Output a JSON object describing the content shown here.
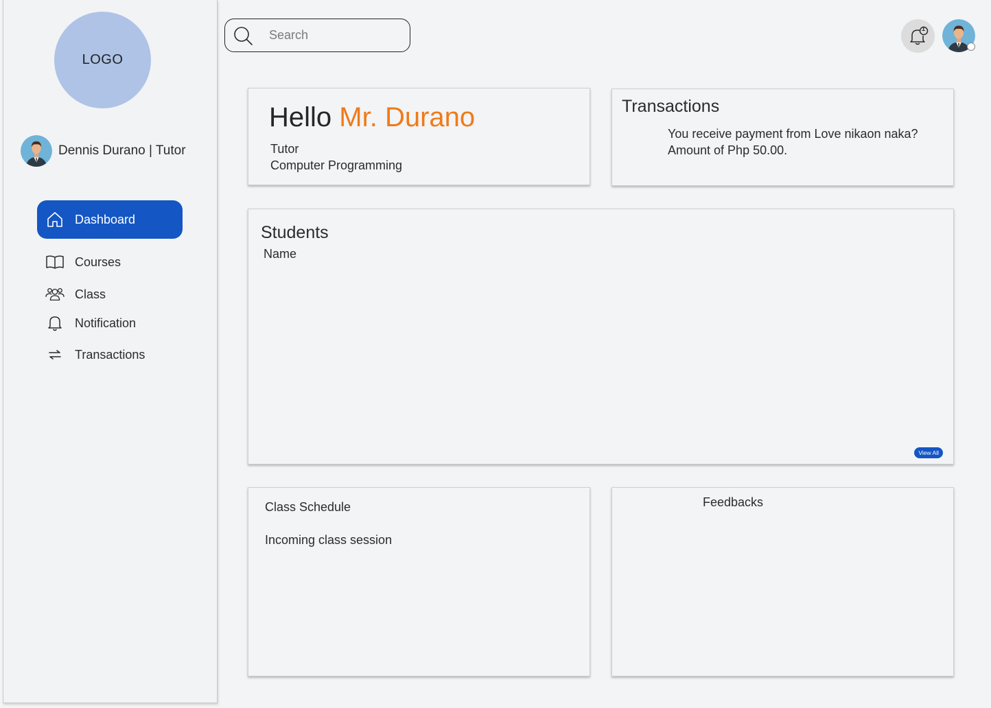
{
  "sidebar": {
    "logo_text": "LOGO",
    "profile_name": "Dennis Durano | Tutor",
    "nav": [
      {
        "label": "Dashboard",
        "icon": "home-icon",
        "active": true
      },
      {
        "label": "Courses",
        "icon": "book-icon",
        "active": false
      },
      {
        "label": "Class",
        "icon": "group-icon",
        "active": false
      },
      {
        "label": "Notification",
        "icon": "bell-icon",
        "active": false
      },
      {
        "label": "Transactions",
        "icon": "swap-icon",
        "active": false
      }
    ]
  },
  "header": {
    "search_placeholder": "Search",
    "notification_count": "1"
  },
  "greeting": {
    "hello": "Hello",
    "name": "Mr. Durano",
    "role": "Tutor",
    "subject": "Computer Programming"
  },
  "transactions": {
    "title": "Transactions",
    "line1": "You receive payment from Love nikaon naka?",
    "line2": "Amount of Php 50.00."
  },
  "students": {
    "title": "Students",
    "column_name": "Name",
    "view_all": "View All"
  },
  "schedule": {
    "title": "Class Schedule",
    "subtitle": "Incoming class session"
  },
  "feedbacks": {
    "title": "Feedbacks"
  },
  "colors": {
    "accent": "#1456c4",
    "highlight": "#f07a19",
    "logo": "#aec3e6"
  }
}
